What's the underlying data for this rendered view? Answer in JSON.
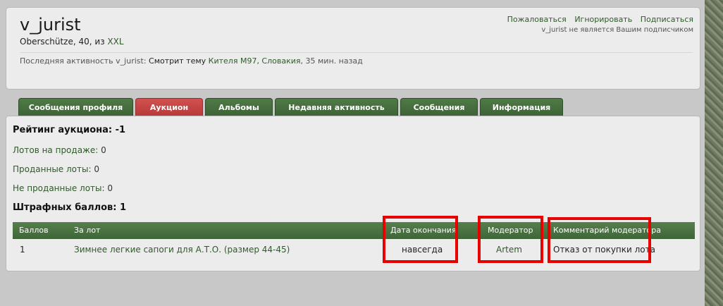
{
  "profile": {
    "username": "v_jurist",
    "location": "Oberschütze",
    "age": "40",
    "from_word": "из",
    "from_place": "XXL",
    "activity_prefix": "Последняя активность v_jurist:",
    "activity_action": "Смотрит тему",
    "activity_topic": "Кителя М97, Словакия",
    "activity_time": "35 мин. назад"
  },
  "actions": {
    "report": "Пожаловаться",
    "ignore": "Игнорировать",
    "subscribe": "Подписаться",
    "subscription_note": "v_jurist не является Вашим подписчиком"
  },
  "tabs": [
    {
      "label": "Сообщения профиля",
      "active": false
    },
    {
      "label": "Аукцион",
      "active": true
    },
    {
      "label": "Альбомы",
      "active": false
    },
    {
      "label": "Недавняя активность",
      "active": false
    },
    {
      "label": "Сообщения",
      "active": false
    },
    {
      "label": "Информация",
      "active": false
    }
  ],
  "auction": {
    "rating_label": "Рейтинг аукциона: -1",
    "lots_on_sale_label": "Лотов на продаже:",
    "lots_on_sale_value": "0",
    "sold_lots_label": "Проданные лоты:",
    "sold_lots_value": "0",
    "unsold_lots_label": "Не проданные лоты:",
    "unsold_lots_value": "0",
    "penalty_label": "Штрафных баллов: 1"
  },
  "penalty_table": {
    "headers": [
      "Баллов",
      "За лот",
      "Дата окончания",
      "Модератор",
      "Комментарий модератора"
    ],
    "rows": [
      [
        "1",
        "Зимнее легкие сапоги для А.Т.О. (размер 44-45)",
        "навсегда",
        "Artem",
        "Отказ от покупки лота"
      ]
    ]
  },
  "colors": {
    "accent_green": "#3f6538",
    "active_tab_red": "#b83a3a",
    "highlight_red": "#e60000",
    "link_green": "#2f5a2a"
  }
}
